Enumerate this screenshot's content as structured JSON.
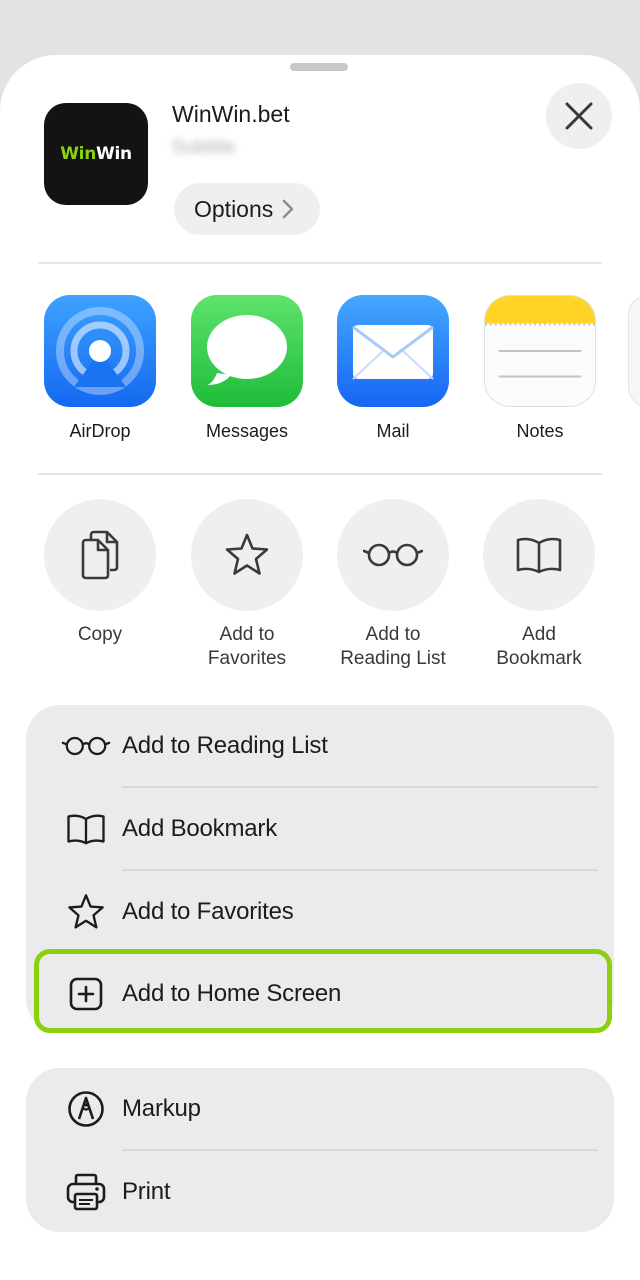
{
  "header": {
    "site_title": "WinWin.bet",
    "site_subtitle": "Subtitle",
    "options_label": "Options",
    "app_logo_part1": "Win",
    "app_logo_part2": "Win"
  },
  "apps": [
    {
      "label": "AirDrop",
      "icon": "airdrop-icon"
    },
    {
      "label": "Messages",
      "icon": "messages-icon"
    },
    {
      "label": "Mail",
      "icon": "mail-icon"
    },
    {
      "label": "Notes",
      "icon": "notes-icon"
    }
  ],
  "quick_actions": [
    {
      "line1": "Copy",
      "line2": "",
      "icon": "copy-icon"
    },
    {
      "line1": "Add to",
      "line2": "Favorites",
      "icon": "star-icon"
    },
    {
      "line1": "Add to",
      "line2": "Reading List",
      "icon": "glasses-icon"
    },
    {
      "line1": "Add",
      "line2": "Bookmark",
      "icon": "book-icon"
    }
  ],
  "list_group_1": [
    {
      "label": "Add to Reading List",
      "icon": "glasses-icon"
    },
    {
      "label": "Add Bookmark",
      "icon": "book-icon"
    },
    {
      "label": "Add to Favorites",
      "icon": "star-icon"
    },
    {
      "label": "Add to Home Screen",
      "icon": "plus-square-icon",
      "highlighted": true
    }
  ],
  "list_group_2": [
    {
      "label": "Markup",
      "icon": "markup-icon"
    },
    {
      "label": "Print",
      "icon": "printer-icon"
    }
  ],
  "colors": {
    "highlight": "#8bd10f",
    "sheet_background": "#ffffff",
    "group_background": "#ebebed"
  }
}
